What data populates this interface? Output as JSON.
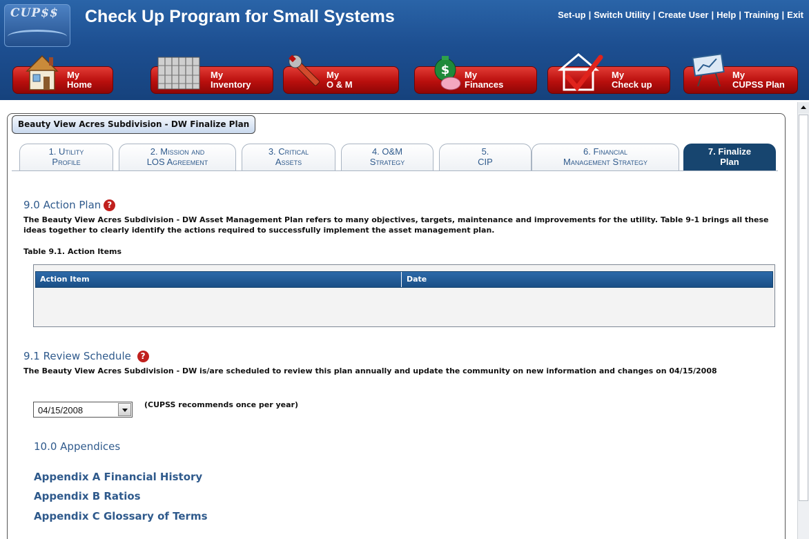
{
  "app": {
    "logo_text": "CUP$$",
    "title": "Check Up Program for Small Systems"
  },
  "top_links": [
    "Set-up",
    "Switch Utility",
    "Create User",
    "Help",
    "Training",
    "Exit"
  ],
  "nav": [
    {
      "line1": "My",
      "line2": "Home",
      "icon": "house-icon"
    },
    {
      "line1": "My",
      "line2": "Inventory",
      "icon": "pipes-stack-icon"
    },
    {
      "line1": "My",
      "line2": "O & M",
      "icon": "wrench-icon"
    },
    {
      "line1": "My",
      "line2": "Finances",
      "icon": "money-bag-piggy-icon"
    },
    {
      "line1": "My",
      "line2": "Check up",
      "icon": "checkmark-house-icon"
    },
    {
      "line1": "My",
      "line2": "CUPSS Plan",
      "icon": "easel-chart-icon"
    }
  ],
  "panel_title": "Beauty View Acres Subdivision - DW Finalize Plan",
  "tabs": [
    {
      "num": "1.",
      "l1": "Utility",
      "l2": "Profile"
    },
    {
      "num": "2.",
      "l1": "Mission and",
      "l2": "LOS Agreement"
    },
    {
      "num": "3.",
      "l1": "Critical",
      "l2": "Assets"
    },
    {
      "num": "4.",
      "l1": "O&M",
      "l2": "Strategy"
    },
    {
      "num": "5.",
      "l1": "",
      "l2": "CIP"
    },
    {
      "num": "6.",
      "l1": "Financial",
      "l2": "Management Strategy"
    },
    {
      "num": "7.",
      "l1": "Finalize",
      "l2": "Plan"
    }
  ],
  "action_plan": {
    "heading": "9.0 Action Plan",
    "text": "The Beauty View Acres Subdivision - DW Asset Management Plan refers to many objectives, targets, maintenance and improvements for the utility. Table 9-1 brings all these ideas together to clearly identify the actions required to successfully implement the asset management plan.",
    "table_caption": "Table 9.1. Action Items",
    "columns": [
      "Action Item",
      "Date"
    ]
  },
  "review": {
    "heading": "9.1 Review Schedule",
    "text": "The Beauty View Acres Subdivision - DW is/are scheduled to review this plan annually and update the community on new information and changes on 04/15/2008",
    "date_value": "04/15/2008",
    "recommend": "(CUPSS recommends once per year)"
  },
  "appendices": {
    "heading": "10.0 Appendices",
    "items": [
      "Appendix A Financial History",
      "Appendix B Ratios",
      "Appendix C Glossary of Terms"
    ]
  },
  "colors": {
    "accent": "#2f5a8c",
    "nav_red": "#b90f0d",
    "header_blue": "#1d4f91",
    "active_tab": "#17456f"
  }
}
